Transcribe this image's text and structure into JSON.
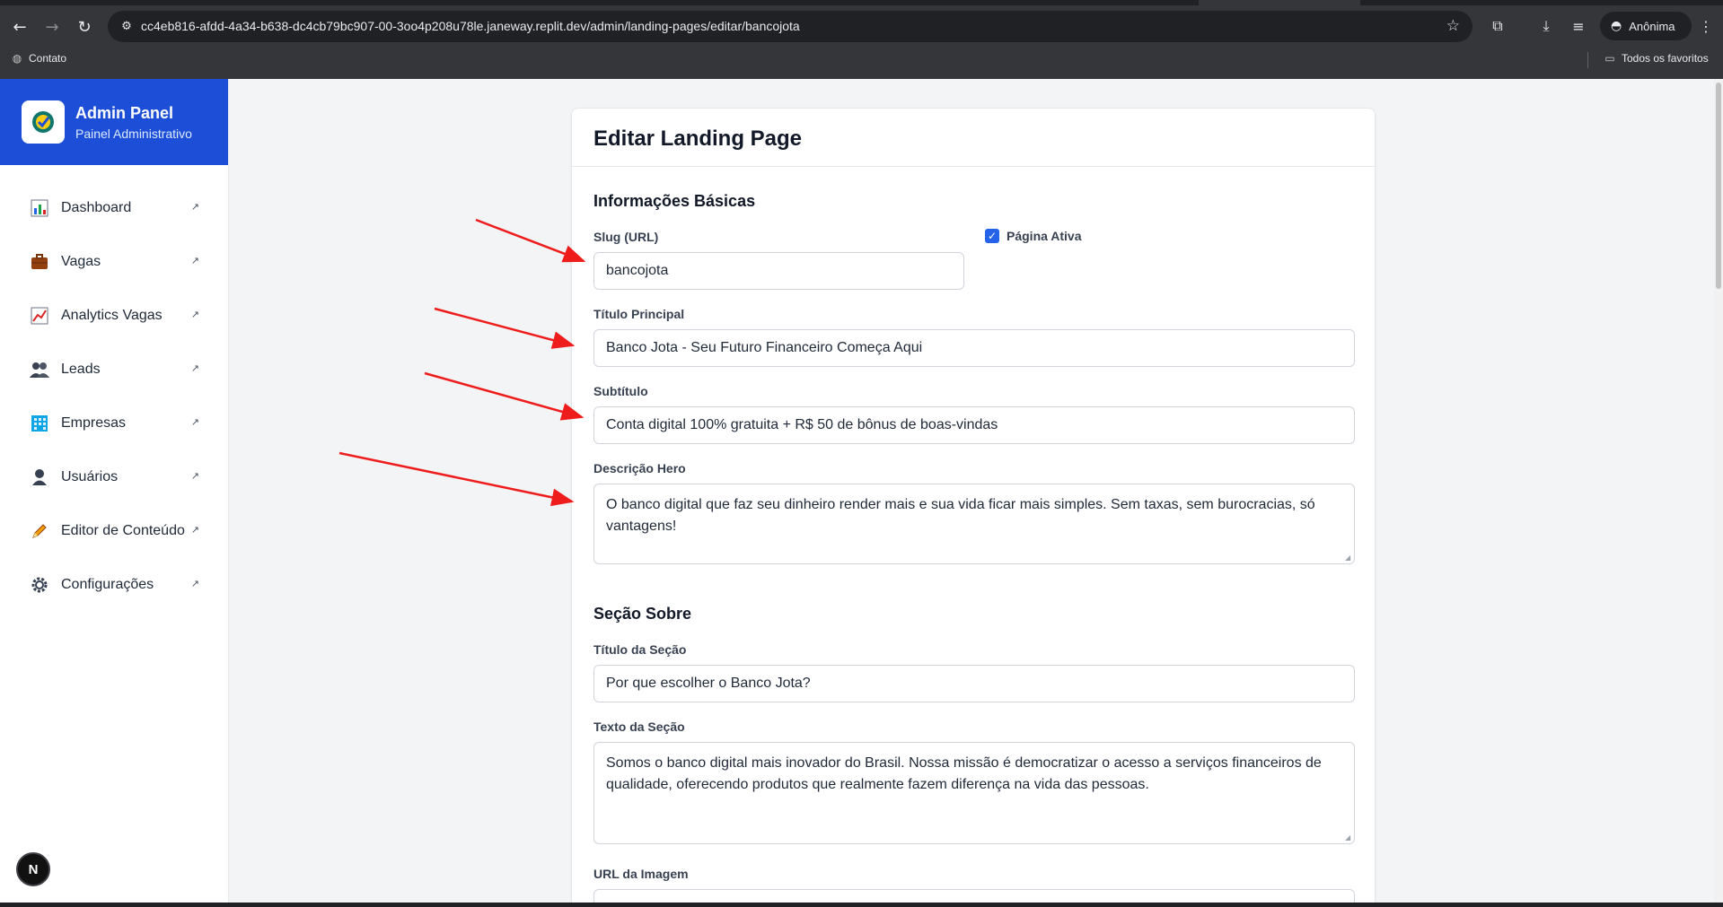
{
  "browser": {
    "url": "cc4eb816-afdd-4a34-b638-dc4cb79bc907-00-3oo4p208u78le.janeway.replit.dev/admin/landing-pages/editar/bancojota",
    "profile_label": "Anônima",
    "bookmarks": {
      "left": "Contato",
      "right": "Todos os favoritos"
    }
  },
  "sidebar": {
    "brand_title": "Admin Panel",
    "brand_subtitle": "Painel Administrativo",
    "items": [
      {
        "label": "Dashboard",
        "icon": "bar-chart-icon"
      },
      {
        "label": "Vagas",
        "icon": "briefcase-icon"
      },
      {
        "label": "Analytics Vagas",
        "icon": "line-chart-icon"
      },
      {
        "label": "Leads",
        "icon": "users-icon"
      },
      {
        "label": "Empresas",
        "icon": "building-icon"
      },
      {
        "label": "Usuários",
        "icon": "user-icon"
      },
      {
        "label": "Editor de Conteúdo",
        "icon": "pencil-icon"
      },
      {
        "label": "Configurações",
        "icon": "gear-icon"
      }
    ],
    "arrow_glyph": "↗",
    "dev_badge": "N"
  },
  "page": {
    "title": "Editar Landing Page",
    "basic": {
      "section_title": "Informações Básicas",
      "slug_label": "Slug (URL)",
      "slug_value": "bancojota",
      "active_label": "Página Ativa",
      "active_checked": true,
      "title_label": "Título Principal",
      "title_value": "Banco Jota - Seu Futuro Financeiro Começa Aqui",
      "subtitle_label": "Subtítulo",
      "subtitle_value": "Conta digital 100% gratuita + R$ 50 de bônus de boas-vindas",
      "hero_label": "Descrição Hero",
      "hero_value": "O banco digital que faz seu dinheiro render mais e sua vida ficar mais simples. Sem taxas, sem burocracias, só vantagens!"
    },
    "about": {
      "section_title": "Seção Sobre",
      "section_title_label": "Título da Seção",
      "section_title_value": "Por que escolher o Banco Jota?",
      "text_label": "Texto da Seção",
      "text_value": "Somos o banco digital mais inovador do Brasil. Nossa missão é democratizar o acesso a serviços financeiros de qualidade, oferecendo produtos que realmente fazem diferença na vida das pessoas.",
      "image_label": "URL da Imagem"
    }
  },
  "colors": {
    "brand_blue": "#1d4ed8",
    "checkbox_blue": "#2563eb",
    "annotation_red": "#ef1c1c"
  }
}
